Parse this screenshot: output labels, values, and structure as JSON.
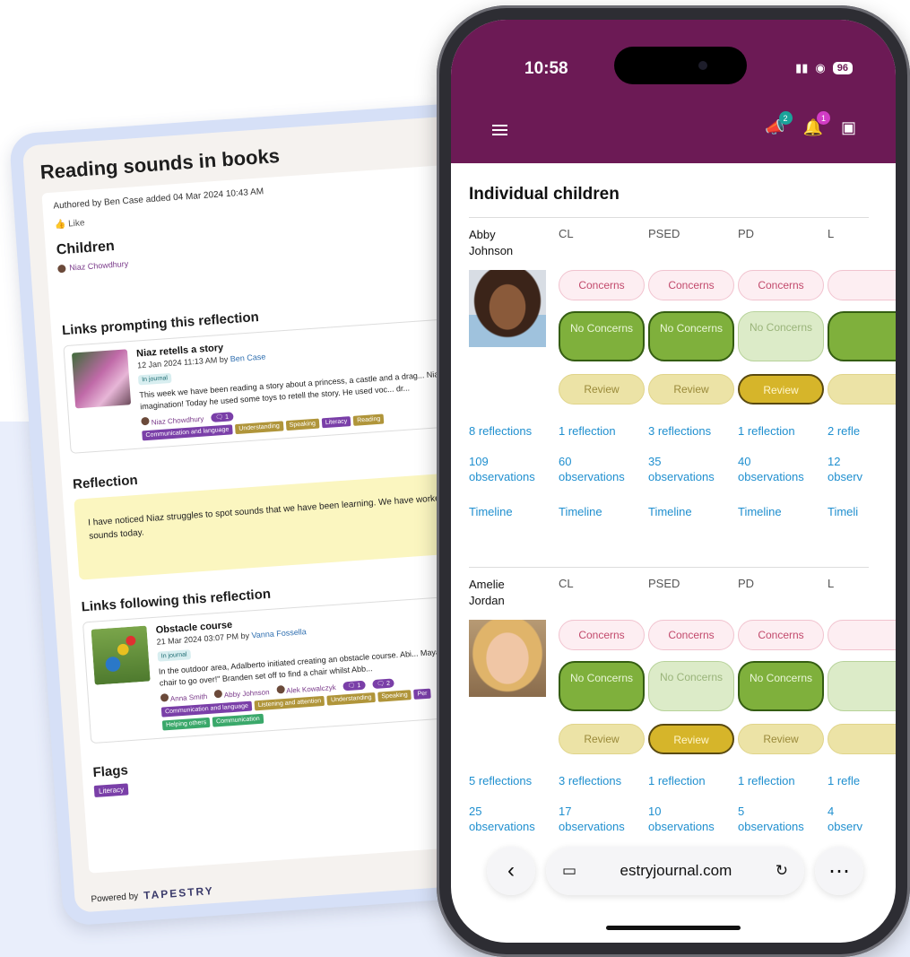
{
  "journal": {
    "title": "Reading sounds in books",
    "authored": "Authored by Ben Case added 04 Mar 2024 10:43 AM",
    "like": "Like",
    "children_heading": "Children",
    "child": "Niaz Chowdhury",
    "links_prompting_heading": "Links prompting this reflection",
    "obs1": {
      "title": "Niaz retells a story",
      "date": "12 Jan 2024 11:13 AM by",
      "author": "Ben Case",
      "status": "In journal",
      "text": "This week we have been reading a story about a princess, a castle and a drag... Niaz's imagination! Today he used some toys to retell the story. He used voc... dr...",
      "person": "Niaz Chowdhury",
      "comments": "1",
      "tags": [
        "Communication and language",
        "Understanding",
        "Speaking",
        "Literacy",
        "Reading"
      ]
    },
    "reflection_heading": "Reflection",
    "reflection_text": "I have noticed Niaz struggles to spot sounds that we have been learning. We have worked on S sounds today.",
    "links_following_heading": "Links following this reflection",
    "obs2": {
      "title": "Obstacle course",
      "date": "21 Mar 2024 03:07 PM by",
      "author": "Vanna Fossella",
      "status": "In journal",
      "text": "In the outdoor area, Adalberto initiated creating an obstacle course. Abi... Maya \"And a chair to go over!\" Branden set off to find a chair whilst Abb...",
      "people": [
        "Anna Smith",
        "Abby Johnson",
        "Alek Kowalczyk"
      ],
      "comments": "1",
      "comments2": "2",
      "tags": [
        "Communication and language",
        "Listening and attention",
        "Understanding",
        "Speaking",
        "Per"
      ],
      "tags2": [
        "Helping others",
        "Communication"
      ]
    },
    "flags_heading": "Flags",
    "flag": "Literacy",
    "powered_by": "Powered by",
    "brand": "TAPESTRY"
  },
  "phone": {
    "time": "10:58",
    "battery": "96",
    "badge_announcements": "2",
    "badge_notifications": "1",
    "page_title": "Individual children",
    "areas": [
      "CL",
      "PSED",
      "PD",
      "L"
    ],
    "labels": {
      "concerns": "Concerns",
      "no_concerns": "No Concerns",
      "review": "Review",
      "timeline": "Timeline"
    },
    "children": [
      {
        "first": "Abby",
        "last": "Johnson",
        "no_concerns_selected": [
          true,
          true,
          false,
          true
        ],
        "review_selected": [
          false,
          false,
          true,
          false
        ],
        "reflections": [
          "8 reflections",
          "1 reflection",
          "3 reflections",
          "1 reflection",
          "2 refle"
        ],
        "observations": [
          "109",
          "60",
          "35",
          "40",
          "12"
        ],
        "obs_label": [
          "observations",
          "observations",
          "observations",
          "observations",
          "observ"
        ],
        "timeline": [
          "Timeline",
          "Timeline",
          "Timeline",
          "Timeline",
          "Timeli"
        ]
      },
      {
        "first": "Amelie",
        "last": "Jordan",
        "no_concerns_selected": [
          true,
          false,
          true,
          false
        ],
        "review_selected": [
          false,
          true,
          false,
          false
        ],
        "reflections": [
          "5 reflections",
          "3 reflections",
          "1 reflection",
          "1 reflection",
          "1 refle"
        ],
        "observations": [
          "25",
          "17",
          "10",
          "5",
          "4"
        ],
        "obs_label": [
          "observations",
          "observations",
          "observations",
          "observations",
          "observ"
        ],
        "timeline": [
          "Timeline",
          "Timeline",
          "Timeline",
          "Timeline",
          "Timeli"
        ]
      }
    ],
    "url": "estryjournal.com"
  }
}
